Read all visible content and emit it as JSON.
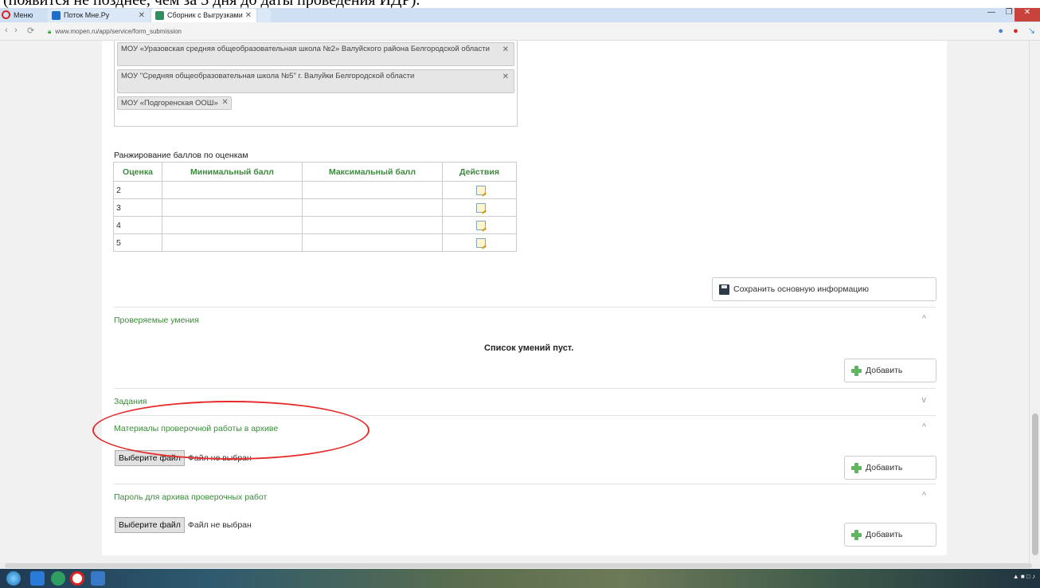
{
  "document_caption": "(появится не позднее, чем за 3 дня до даты проведения ИДР).",
  "browser": {
    "menu_label": "Меню",
    "tabs": [
      {
        "label": "Поток Мне.Ру",
        "color": "#1a6fc9"
      },
      {
        "label": "Сборник с Выгрузками",
        "color": "#2f8f5f"
      }
    ],
    "minimize": "—",
    "maximize": "❐",
    "close": "✕",
    "back": "‹",
    "forward": "›",
    "reload": "⟳",
    "url": "www.mopen.ru/app/service/form_submission"
  },
  "schools": {
    "tags": [
      {
        "label": "МОУ «Уразовская средняя общеобразовательная школа №2» Валуйского района Белгородской области"
      },
      {
        "label": "МОУ \"Средняя общеобразовательная школа №5\" г. Валуйки Белгородской области"
      },
      {
        "label": "МОУ «Подгоренская ООШ»"
      }
    ],
    "remove_symbol": "✕"
  },
  "ranking": {
    "title": "Ранжирование баллов по оценкам",
    "columns": [
      "Оценка",
      "Минимальный балл",
      "Максимальный балл",
      "Действия"
    ],
    "rows": [
      {
        "grade": "2",
        "min": "",
        "max": ""
      },
      {
        "grade": "3",
        "min": "",
        "max": ""
      },
      {
        "grade": "4",
        "min": "",
        "max": ""
      },
      {
        "grade": "5",
        "min": "",
        "max": ""
      }
    ]
  },
  "save_button": "Сохранить основную информацию",
  "sections": {
    "skills": {
      "title": "Проверяемые умения",
      "chevron": "^",
      "empty_text": "Список умений пуст.",
      "add_label": "Добавить"
    },
    "tasks": {
      "title": "Задания",
      "chevron": "v"
    },
    "archive": {
      "title": "Материалы проверочной работы в архиве",
      "chevron": "^",
      "file_button": "Выберите файл",
      "file_status": "Файл не выбран",
      "add_label": "Добавить"
    },
    "password": {
      "title": "Пароль для архива проверочных работ",
      "chevron": "^",
      "file_button": "Выберите файл",
      "file_status": "Файл не выбран",
      "add_label": "Добавить"
    }
  },
  "colors": {
    "accent_green": "#3b8a3b",
    "annotation_red": "#e52b2b"
  }
}
